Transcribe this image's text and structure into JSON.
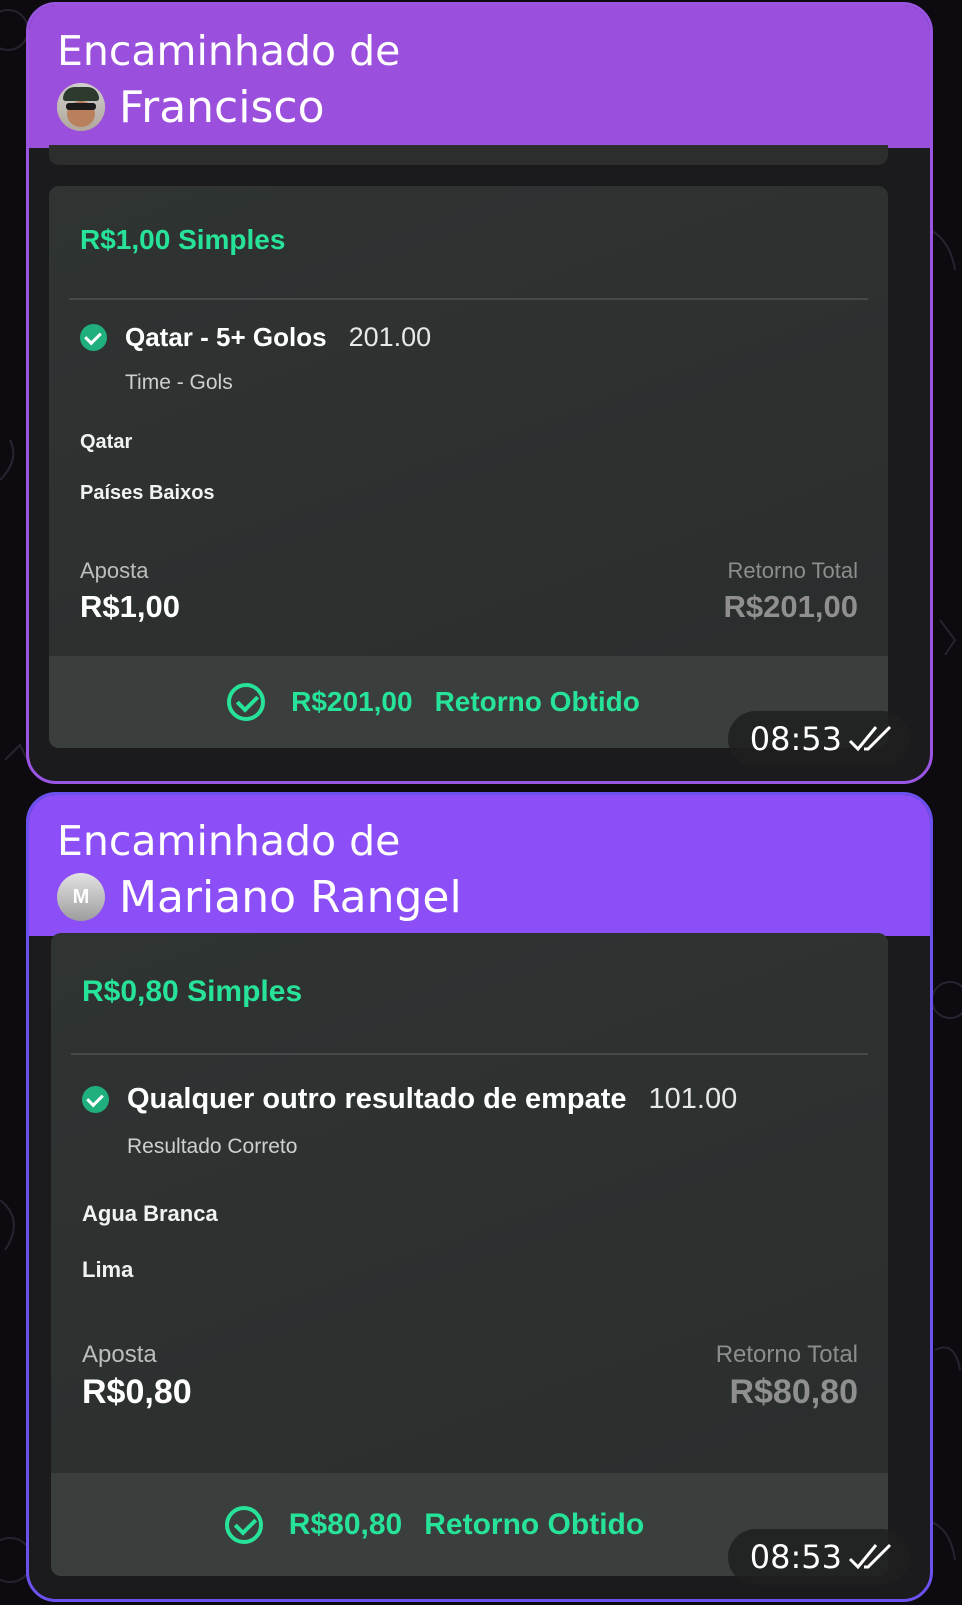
{
  "messages": [
    {
      "forwarded_label": "Encaminhado de",
      "sender": "Francisco",
      "avatar": "photo",
      "bet_title": "R$1,00 Simples",
      "selection": {
        "name": "Qatar - 5+ Golos",
        "odds": "201.00",
        "market": "Time - Gols"
      },
      "teams": [
        "Qatar",
        "Países Baixos"
      ],
      "stake_label": "Aposta",
      "stake_value": "R$1,00",
      "return_label": "Retorno Total",
      "return_value": "R$201,00",
      "result_amount": "R$201,00",
      "result_text": "Retorno Obtido",
      "time": "08:53",
      "status_icon": "double-check-icon"
    },
    {
      "forwarded_label": "Encaminhado de",
      "sender": "Mariano Rangel",
      "avatar_initial": "M",
      "bet_title": "R$0,80 Simples",
      "selection": {
        "name": "Qualquer outro resultado de empate",
        "odds": "101.00",
        "market": "Resultado Correto"
      },
      "teams": [
        "Agua Branca",
        "Lima"
      ],
      "stake_label": "Aposta",
      "stake_value": "R$0,80",
      "return_label": "Retorno Total",
      "return_value": "R$80,80",
      "result_amount": "R$80,80",
      "result_text": "Retorno Obtido",
      "time": "08:53",
      "status_icon": "double-check-icon"
    }
  ],
  "colors": {
    "accent_green": "#27e39a",
    "header_purple_1": "#9b4fdd",
    "header_purple_2": "#8c4ef7",
    "card_bg": "#2f3433"
  }
}
